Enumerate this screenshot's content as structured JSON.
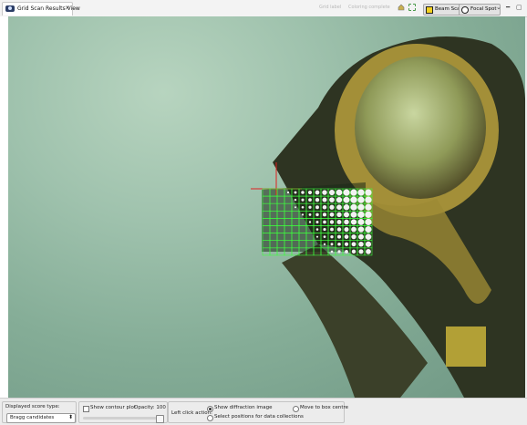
{
  "window": {
    "tab_label": "Grid Scan Results View",
    "toolbar": {
      "grid_label": "Grid label",
      "coloring_label": "Coloring complete",
      "beam_scale": "Beam Scale",
      "focal_spot": "Focal Spot"
    }
  },
  "viewer": {
    "grid": {
      "columns": 15,
      "rows": 9,
      "score_type": "Bragg candidates"
    }
  },
  "controls": {
    "score_type_label": "Displayed score type:",
    "score_type_value": "Bragg candidates",
    "contour_label": "Show contour plot",
    "opacity_label": "Opacity: 100",
    "opacity": 100,
    "left_click_label": "Left click action:",
    "action_diffraction": "Show diffraction image",
    "action_box_centre": "Move to box centre",
    "action_positions": "Select positions for data collections"
  },
  "colors": {
    "grid_line": "#3dff3d",
    "crosshair": "#e02020",
    "accent_box": "#c9b43a"
  }
}
